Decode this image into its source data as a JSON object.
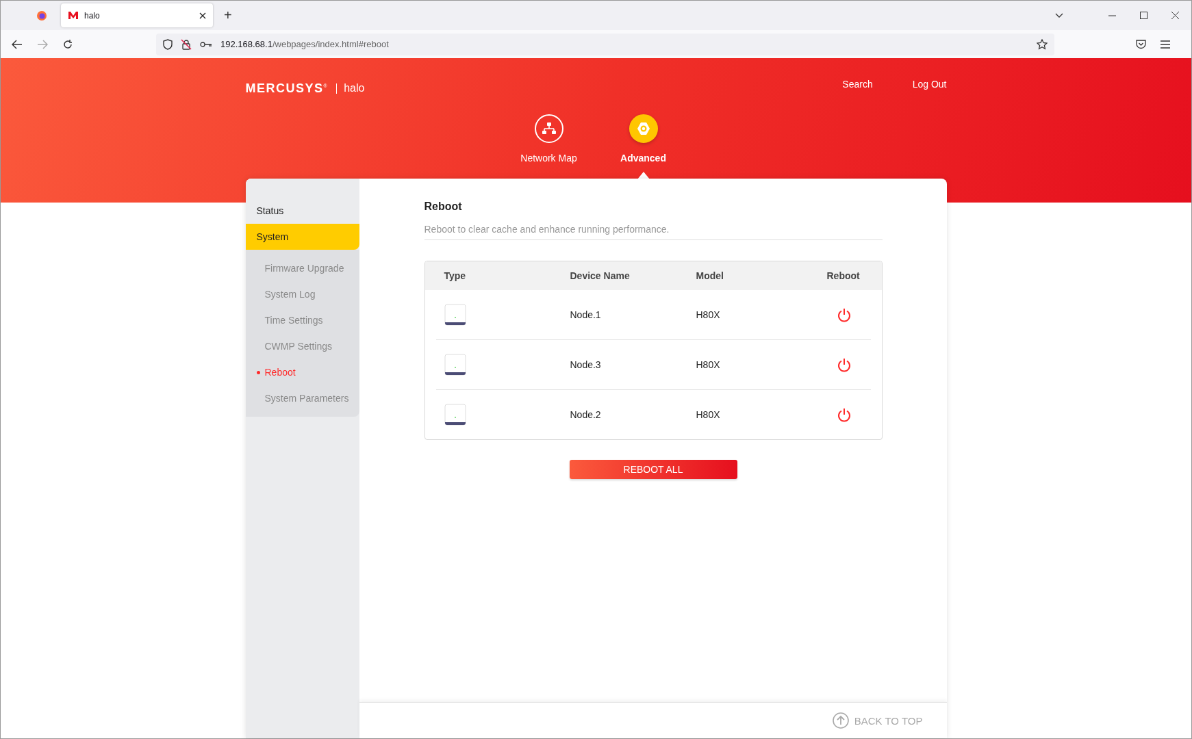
{
  "browser": {
    "tab_title": "halo",
    "new_tab": "+",
    "url_host": "192.168.68.1",
    "url_path": "/webpages/index.html#reboot"
  },
  "header": {
    "brand": "MERCUSYS$^{®}$",
    "product": "halo",
    "links": [
      "Search",
      "Log Out"
    ],
    "nav": [
      {
        "label": "Network Map",
        "selected": false,
        "kind": "network"
      },
      {
        "label": "Advanced",
        "selected": true,
        "kind": "gear"
      }
    ]
  },
  "sidebar": {
    "items": [
      {
        "label": "Status",
        "selected": false
      },
      {
        "label": "System",
        "selected": true,
        "children": [
          {
            "label": "Firmware Upgrade",
            "selected": false
          },
          {
            "label": "System Log",
            "selected": false
          },
          {
            "label": "Time Settings",
            "selected": false
          },
          {
            "label": "CWMP Settings",
            "selected": false
          },
          {
            "label": "Reboot",
            "selected": true
          },
          {
            "label": "System Parameters",
            "selected": false
          }
        ]
      }
    ]
  },
  "page": {
    "title": "Reboot",
    "description": "Reboot to clear cache and enhance running performance."
  },
  "table": {
    "columns": [
      "Type",
      "Device Name",
      "Model",
      "Reboot"
    ],
    "rows": [
      {
        "device_name": "Node.1",
        "model": "H80X"
      },
      {
        "device_name": "Node.3",
        "model": "H80X"
      },
      {
        "device_name": "Node.2",
        "model": "H80X"
      }
    ]
  },
  "reboot_all_button": "REBOOT ALL",
  "back_to_top": "BACK TO TOP"
}
